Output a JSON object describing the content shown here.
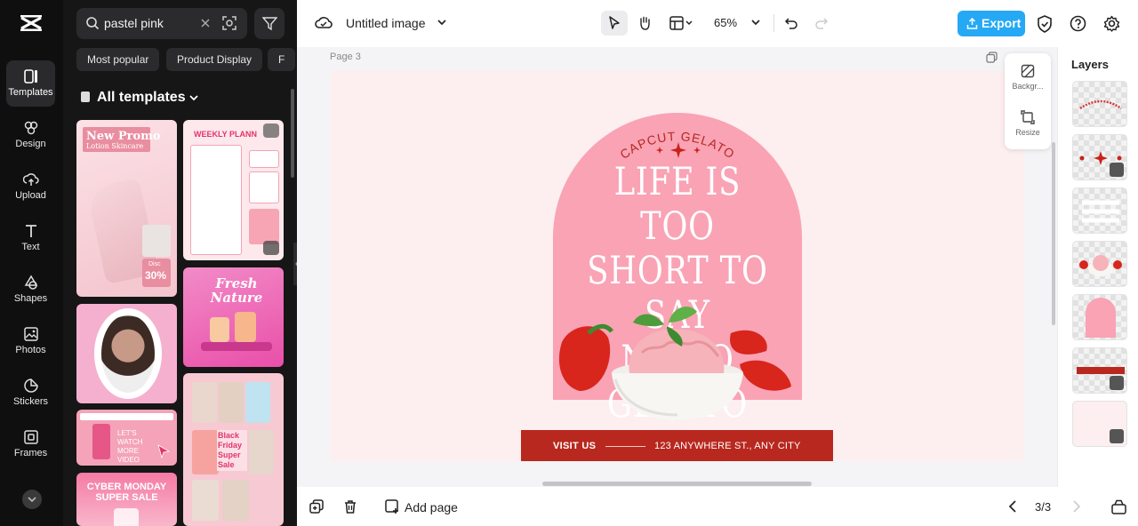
{
  "rail": {
    "items": [
      {
        "label": "Templates",
        "icon": "templates-icon"
      },
      {
        "label": "Design",
        "icon": "design-icon"
      },
      {
        "label": "Upload",
        "icon": "upload-icon"
      },
      {
        "label": "Text",
        "icon": "text-icon"
      },
      {
        "label": "Shapes",
        "icon": "shapes-icon"
      },
      {
        "label": "Photos",
        "icon": "photos-icon"
      },
      {
        "label": "Stickers",
        "icon": "stickers-icon"
      },
      {
        "label": "Frames",
        "icon": "frames-icon"
      }
    ]
  },
  "panel": {
    "search_value": "pastel pink",
    "chips": [
      "Most popular",
      "Product Display",
      "F"
    ],
    "section_title": "All templates",
    "templates": {
      "promo_title": "New Promo",
      "promo_sub": "Lotion Skincare",
      "promo_disc": "Disc",
      "promo_pct": "30%",
      "planner_title": "WEEKLY PLANN",
      "fresh_title": "Fresh Nature",
      "watch_text": "LET'S WATCH MORE VIDEO",
      "friday_text": "Black Friday Super Sale",
      "cyber_text": "CYBER MONDAY SUPER SALE"
    }
  },
  "topbar": {
    "title": "Untitled image",
    "zoom": "65%",
    "export_label": "Export"
  },
  "canvas": {
    "page_label": "Page 3",
    "brand": "CAPCUT GELATO",
    "headline": [
      "LIFE IS TOO",
      "SHORT TO SAY",
      "NO TO GELATO"
    ],
    "banner_left": "VISIT US",
    "banner_right": "123 ANYWHERE ST., ANY CITY",
    "float_background": "Backgr...",
    "float_resize": "Resize"
  },
  "bottombar": {
    "add_page": "Add page",
    "page_count": "3/3"
  },
  "layers": {
    "title": "Layers"
  },
  "colors": {
    "accent": "#25a9f4",
    "arch": "#f9a3b5",
    "design_bg": "#fdeeef",
    "banner": "#b8281f"
  }
}
